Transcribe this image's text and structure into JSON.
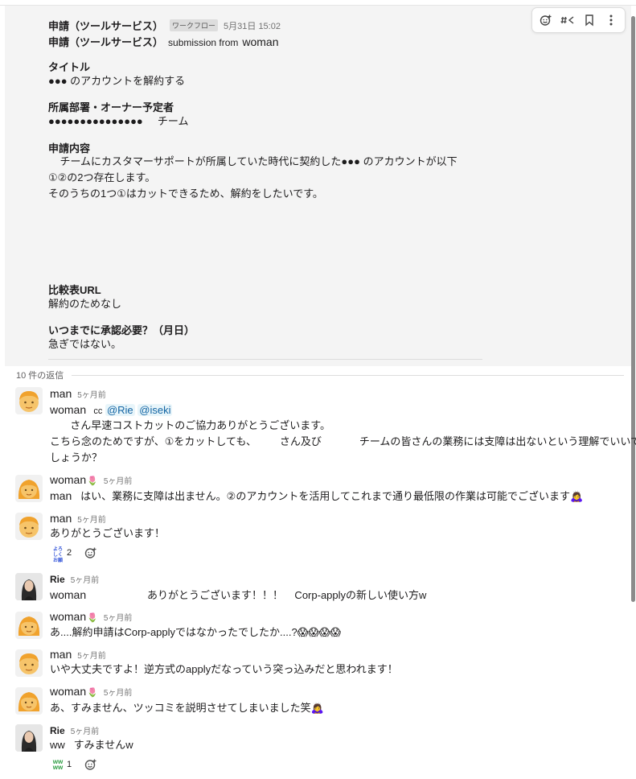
{
  "toolbar": {
    "items": [
      "add-reaction",
      "reply-in-channel",
      "bookmark",
      "more"
    ]
  },
  "workflow": {
    "title": "申請（ツールサービス）",
    "badge": "ワークフロー",
    "time": "5月31日 15:02",
    "title2": "申請（ツールサービス）",
    "submission_from": "submission from",
    "submitter": "woman",
    "fields": [
      {
        "label": "タイトル",
        "value": "●●● のアカウントを解約する"
      },
      {
        "label": "所属部署・オーナー予定者",
        "value": "●●●●●●●●●●●●●●●     チーム"
      },
      {
        "label": "申請内容",
        "value": "    チームにカスタマーサポートが所属していた時代に契約した●●● のアカウントが以下\n①②の2つ存在します。\nそのうちの1つ①はカットできるため、解約をしたいです。"
      },
      {
        "label": "比較表URL",
        "value": "解約のためなし"
      },
      {
        "label": "いつまでに承認必要？（月日）",
        "value": "急ぎではない。"
      }
    ]
  },
  "replies_count": "10 件の返信",
  "messages": [
    {
      "user": "man",
      "time": "5ヶ月前",
      "mention_user": "woman",
      "cc": "cc",
      "mentions": [
        "@Rie",
        "@iseki"
      ],
      "text": "       さん早速コストカットのご協力ありがとうございます。\nこちら念のためですが、①をカットしても、        さん及び             チームの皆さんの業務には支障は出ないという理解でいいで\nしょうか？"
    },
    {
      "user": "woman",
      "time": "5ヶ月前",
      "mention_user": "man",
      "text": "   はい、業務に支障は出ません。②のアカウントを活用してこれまで通り最低限の作業は可能でございます"
    },
    {
      "user": "man",
      "time": "5ヶ月前",
      "text": "ありがとうございます！",
      "reaction_count": "2"
    },
    {
      "user": "Rie",
      "time": "5ヶ月前",
      "mention_user": "woman",
      "text": "                     ありがとうございます！！！    Corp-applyの新しい使い方w"
    },
    {
      "user": "woman",
      "time": "5ヶ月前",
      "text": "あ....解約申請はCorp-applyではなかったでしたか....?"
    },
    {
      "user": "man",
      "time": "5ヶ月前",
      "text": "いや大丈夫ですよ！逆方式のapplyだなっていう突っ込みだと思われます！"
    },
    {
      "user": "woman",
      "time": "5ヶ月前",
      "text": "あ、すみません、ツッコミを説明させてしまいました笑"
    },
    {
      "user": "Rie",
      "time": "5ヶ月前",
      "text": "ww   すみませんw",
      "reaction_count": "1"
    }
  ]
}
